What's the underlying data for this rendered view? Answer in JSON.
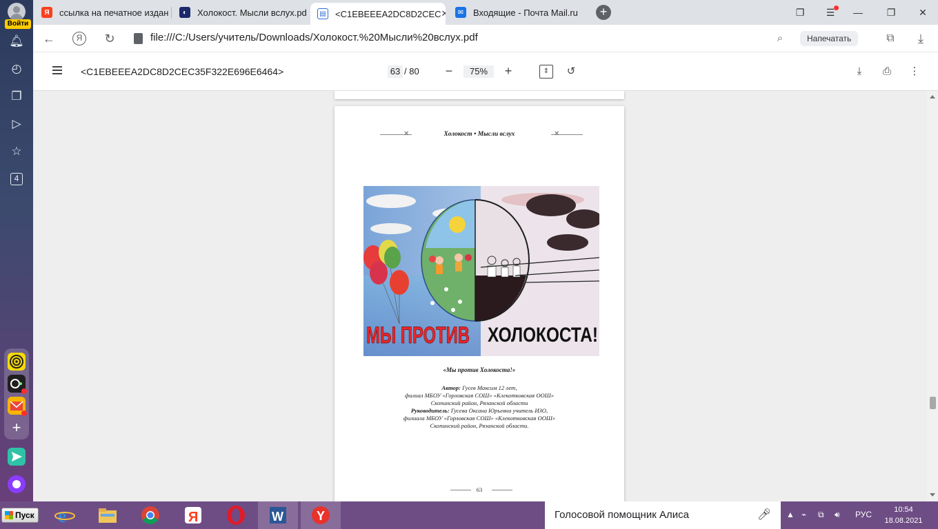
{
  "sidebar": {
    "login_label": "Войти",
    "icons": [
      "bell-icon",
      "history-icon",
      "collections-icon",
      "play-icon",
      "star-icon"
    ],
    "tab_count": "4"
  },
  "tabs": [
    {
      "label": "ссылка на печатное издан",
      "favicon": "yandex-icon",
      "active": false
    },
    {
      "label": "Холокост. Мысли вслух.pd",
      "favicon": "globe-icon",
      "active": false
    },
    {
      "label": "<C1EBEEEA2DC8D2CEC",
      "favicon": "pdf-icon",
      "active": true
    },
    {
      "label": "Входящие - Почта Mail.ru",
      "favicon": "mail-icon",
      "active": false
    }
  ],
  "address": {
    "url": "file:///C:/Users/учитель/Downloads/Холокост.%20Мысли%20вслух.pdf",
    "print_label": "Напечатать"
  },
  "pdf": {
    "title": "<C1EBEEEA2DC8D2CEC35F322E696E6464>",
    "page_current": "63",
    "page_total": "/ 80",
    "zoom": "75%"
  },
  "page": {
    "header": "Холокост • Мысли вслух",
    "drawing_text_left": "МЫ ПРОТИВ",
    "drawing_text_right": "ХОЛОКОСТА!",
    "caption_title": "«Мы против Холокоста!»",
    "author_label": "Автор:",
    "author_text": "Гусев Максим 12 лет,",
    "author_line2": "филиал МБОУ «Горловская СОШ» «Клекотковская ООШ»",
    "author_line3": "Скопинский район, Рязанской области",
    "supervisor_label": "Руководитель:",
    "supervisor_text": "Гусева Оксана Юрьевна учитель ИЗО,",
    "supervisor_line2": "филиала МБОУ «Горловская СОШ» «Клекотковская ООШ»",
    "supervisor_line3": "Скопинский район, Рязанской области.",
    "page_number": "63"
  },
  "taskbar": {
    "start_label": "Пуск",
    "alice_label": "Голосовой помощник Алиса",
    "lang": "РУС",
    "time": "10:54",
    "date": "18.08.2021"
  }
}
